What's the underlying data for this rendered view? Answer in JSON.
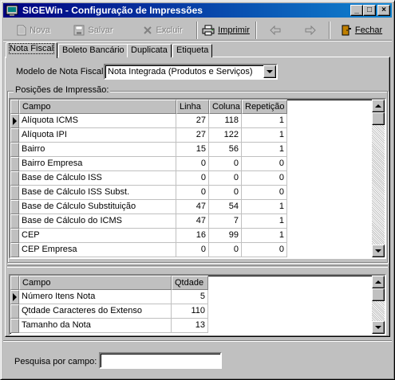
{
  "window": {
    "title": "SIGEWin - Configuração de Impressões",
    "controls": {
      "minimize": "_",
      "maximize": "□",
      "close": "×"
    }
  },
  "toolbar": {
    "new_label": "Nova",
    "save_label": "Salvar",
    "delete_label": "Excluir",
    "print_label": "Imprimir",
    "close_label": "Fechar"
  },
  "tabs": [
    "Nota Fiscal",
    "Boleto Bancário",
    "Duplicata",
    "Etiqueta"
  ],
  "form": {
    "model_label": "Modelo de Nota Fiscal",
    "model_value": "Nota Integrada (Produtos e Serviços)",
    "positions_label": "Posições de Impressão:"
  },
  "positions_grid": {
    "columns": [
      "Campo",
      "Linha",
      "Coluna",
      "Repetição"
    ],
    "rows": [
      {
        "campo": "Alíquota ICMS",
        "linha": "27",
        "coluna": "118",
        "repeticao": "1"
      },
      {
        "campo": "Alíquota IPI",
        "linha": "27",
        "coluna": "122",
        "repeticao": "1"
      },
      {
        "campo": "Bairro",
        "linha": "15",
        "coluna": "56",
        "repeticao": "1"
      },
      {
        "campo": "Bairro Empresa",
        "linha": "0",
        "coluna": "0",
        "repeticao": "0"
      },
      {
        "campo": "Base de Cálculo ISS",
        "linha": "0",
        "coluna": "0",
        "repeticao": "0"
      },
      {
        "campo": "Base de Cálculo ISS Subst.",
        "linha": "0",
        "coluna": "0",
        "repeticao": "0"
      },
      {
        "campo": "Base de Cálculo Substituição",
        "linha": "47",
        "coluna": "54",
        "repeticao": "1"
      },
      {
        "campo": "Base de Cálculo do ICMS",
        "linha": "47",
        "coluna": "7",
        "repeticao": "1"
      },
      {
        "campo": "CEP",
        "linha": "16",
        "coluna": "99",
        "repeticao": "1"
      },
      {
        "campo": "CEP Empresa",
        "linha": "0",
        "coluna": "0",
        "repeticao": "0"
      }
    ]
  },
  "quantity_grid": {
    "columns": [
      "Campo",
      "Qtdade"
    ],
    "rows": [
      {
        "campo": "Número Itens Nota",
        "qtdade": "5"
      },
      {
        "campo": "Qtdade Caracteres do Extenso",
        "qtdade": "110"
      },
      {
        "campo": "Tamanho da Nota",
        "qtdade": "13"
      }
    ]
  },
  "search": {
    "label": "Pesquisa por campo:",
    "value": ""
  }
}
